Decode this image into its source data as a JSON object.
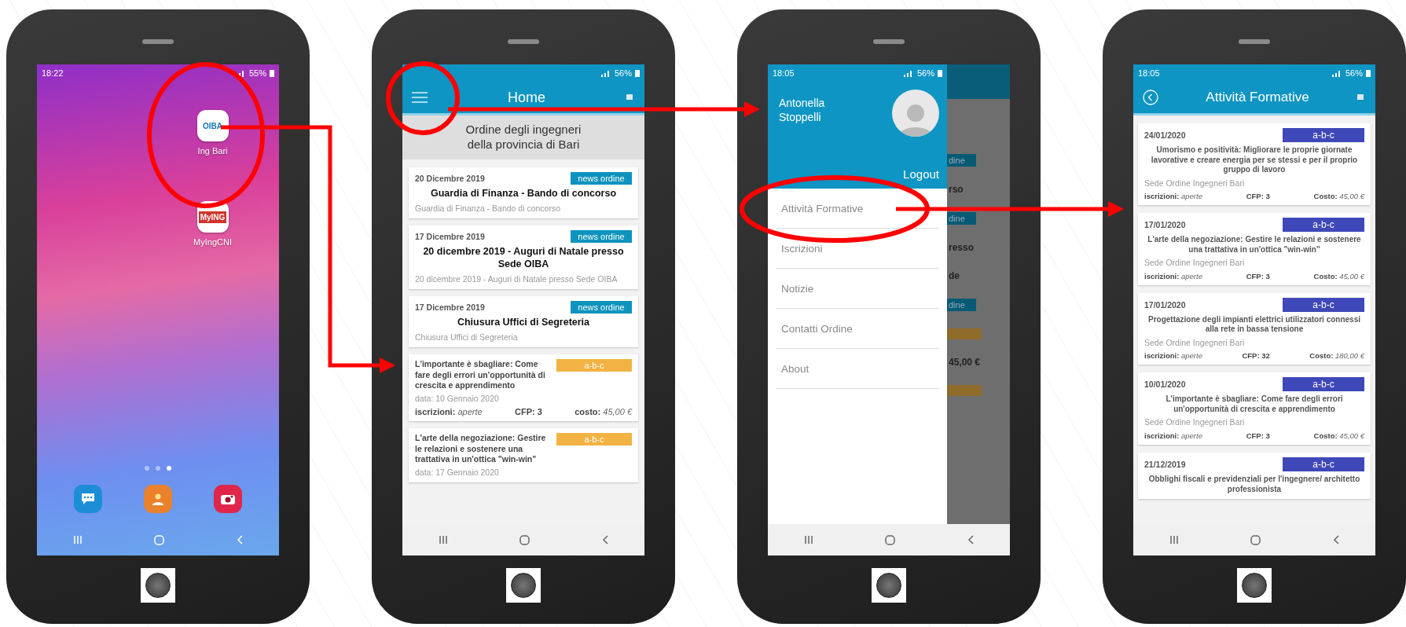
{
  "phones": [
    {
      "kind": "launcher",
      "status": {
        "time": "18:22",
        "battery": "55%"
      },
      "apps": [
        {
          "label": "Ing Bari",
          "logo": "OIBA",
          "kind": "oiba"
        },
        {
          "label": "MyIngCNI",
          "logo": "MyING",
          "kind": "mying"
        }
      ],
      "page_dots": [
        {
          "selected": false
        },
        {
          "selected": false
        },
        {
          "selected": true
        }
      ],
      "dock": [
        {
          "kind": "messages"
        },
        {
          "kind": "contacts"
        },
        {
          "kind": "camera"
        }
      ]
    },
    {
      "kind": "feed",
      "status": {
        "battery": "56%"
      },
      "title": "Home",
      "banner": [
        "Ordine degli ingegneri",
        "della provincia di Bari"
      ],
      "items": [
        {
          "kind": "news",
          "date": "20 Dicembre 2019",
          "tag": "news ordine",
          "color": "#0d93bd",
          "title": "Guardia di Finanza - Bando di concorso",
          "summary": "Guardia di Finanza - Bando di concorso"
        },
        {
          "kind": "news",
          "date": "17 Dicembre 2019",
          "tag": "news ordine",
          "color": "#0d93bd",
          "title": "20 dicembre 2019 - Auguri di Natale presso Sede OIBA",
          "summary": "20 dicembre 2019 - Auguri di Natale presso Sede OIBA"
        },
        {
          "kind": "news",
          "date": "17 Dicembre 2019",
          "tag": "news ordine",
          "color": "#0d93bd",
          "title": "Chiusura Uffici di Segreteria",
          "summary": "Chiusura Uffici di Segreteria"
        },
        {
          "kind": "course",
          "tag": "a-b-c",
          "color": "#f2b344",
          "title": "L'importante è sbagliare: Come fare degli errori un'opportunità di crescita e apprendimento",
          "date": "data: 10 Gennaio 2020",
          "signup_label": "iscrizioni:",
          "signup": "aperte",
          "cfp": "CFP: 3",
          "cost_label": "costo:",
          "cost": "45,00 €"
        },
        {
          "kind": "course",
          "tag": "a-b-c",
          "color": "#f2b344",
          "title": "L'arte della negoziazione: Gestire le relazioni e sostenere una trattativa in un'ottica \"win-win\"",
          "date": "data: 17 Gennaio 2020"
        }
      ]
    },
    {
      "kind": "drawer",
      "status": {
        "time": "18:05",
        "battery": "56%"
      },
      "user": "Antonella Stoppelli",
      "logout": "Logout",
      "menu": [
        {
          "label": "Attività Formative"
        },
        {
          "label": "Iscrizioni"
        },
        {
          "label": "Notizie"
        },
        {
          "label": "Contatti Ordine"
        },
        {
          "label": "About"
        }
      ],
      "backdrop": [
        {
          "kind": "tag",
          "text": "dine"
        },
        {
          "kind": "text",
          "text": "rso"
        },
        {
          "kind": "tag",
          "text": "dine"
        },
        {
          "kind": "text",
          "text": "resso"
        },
        {
          "kind": "text",
          "text": "de"
        },
        {
          "kind": "tag",
          "text": "dine"
        },
        {
          "kind": "bar"
        },
        {
          "kind": "text",
          "text": "45,00 €"
        },
        {
          "kind": "bar"
        }
      ]
    },
    {
      "kind": "courses",
      "status": {
        "time": "18:05",
        "battery": "56%"
      },
      "title": "Attività Formative",
      "items": [
        {
          "date": "24/01/2020",
          "tag": "a-b-c",
          "color": "#3f48b8",
          "title": "Umorismo e positività: Migliorare le proprie giornate lavorative e creare energia per se stessi e per il proprio gruppo di lavoro",
          "place": "Sede Ordine Ingegneri Bari",
          "signup_label": "iscrizioni:",
          "signup": "aperte",
          "cfp": "CFP: 3",
          "cost_label": "Costo:",
          "cost": "45,00 €"
        },
        {
          "date": "17/01/2020",
          "tag": "a-b-c",
          "color": "#3f48b8",
          "title": "L'arte della negoziazione: Gestire le relazioni e sostenere una trattativa in un'ottica \"win-win\"",
          "place": "Sede Ordine Ingegneri Bari",
          "signup_label": "iscrizioni:",
          "signup": "aperte",
          "cfp": "CFP: 3",
          "cost_label": "Costo:",
          "cost": "45,00 €"
        },
        {
          "date": "17/01/2020",
          "tag": "a-b-c",
          "color": "#3f48b8",
          "title": "Progettazione degli impianti elettrici utilizzatori connessi alla rete in bassa tensione",
          "place": "Sede Ordine Ingegneri Bari",
          "signup_label": "iscrizioni:",
          "signup": "aperte",
          "cfp": "CFP: 32",
          "cost_label": "Costo:",
          "cost": "180,00 €"
        },
        {
          "date": "10/01/2020",
          "tag": "a-b-c",
          "color": "#3f48b8",
          "title": "L'importante è sbagliare: Come fare degli errori un'opportunità di crescita e apprendimento",
          "place": "Sede Ordine Ingegneri Bari",
          "signup_label": "iscrizioni:",
          "signup": "aperte",
          "cfp": "CFP: 3",
          "cost_label": "Costo:",
          "cost": "45,00 €"
        },
        {
          "date": "21/12/2019",
          "tag": "a-b-c",
          "color": "#3f48b8",
          "title": "Obblighi fiscali e previdenziali per l'ingegnere/ architetto professionista"
        }
      ]
    }
  ]
}
